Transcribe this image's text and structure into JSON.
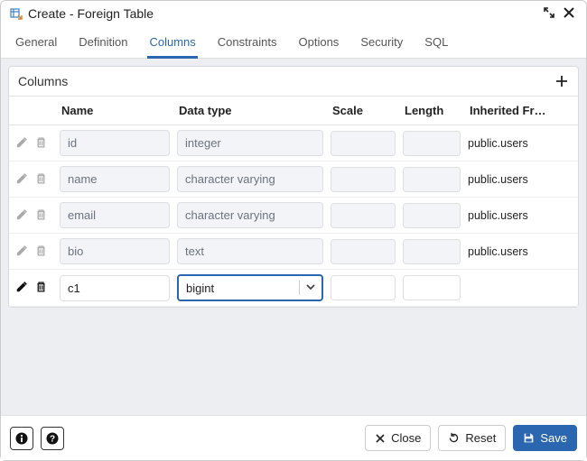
{
  "window": {
    "title": "Create - Foreign Table"
  },
  "tabs": [
    {
      "label": "General"
    },
    {
      "label": "Definition"
    },
    {
      "label": "Columns",
      "active": true
    },
    {
      "label": "Constraints"
    },
    {
      "label": "Options"
    },
    {
      "label": "Security"
    },
    {
      "label": "SQL"
    }
  ],
  "panel": {
    "title": "Columns"
  },
  "headers": {
    "name": "Name",
    "datatype": "Data type",
    "scale": "Scale",
    "length": "Length",
    "inherited": "Inherited Fr…"
  },
  "rows": [
    {
      "name": "id",
      "datatype": "integer",
      "scale": "",
      "length": "",
      "inherited": "public.users",
      "editable": false
    },
    {
      "name": "name",
      "datatype": "character varying",
      "scale": "",
      "length": "",
      "inherited": "public.users",
      "editable": false
    },
    {
      "name": "email",
      "datatype": "character varying",
      "scale": "",
      "length": "",
      "inherited": "public.users",
      "editable": false
    },
    {
      "name": "bio",
      "datatype": "text",
      "scale": "",
      "length": "",
      "inherited": "public.users",
      "editable": false
    },
    {
      "name": "c1",
      "datatype": "bigint",
      "scale": "",
      "length": "",
      "inherited": "",
      "editable": true
    }
  ],
  "footer": {
    "close": "Close",
    "reset": "Reset",
    "save": "Save"
  }
}
